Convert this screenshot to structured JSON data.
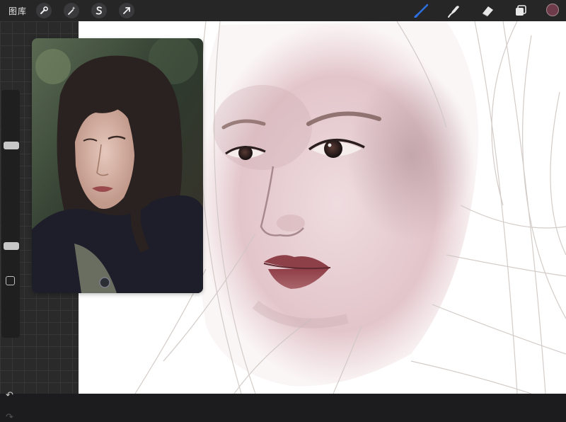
{
  "toolbar": {
    "gallery_label": "图库",
    "left_tools": [
      {
        "name": "actions",
        "icon": "wrench-icon"
      },
      {
        "name": "adjustments",
        "icon": "magic-wand-icon"
      },
      {
        "name": "selection",
        "icon": "selection-s-icon"
      },
      {
        "name": "transform",
        "icon": "arrow-cursor-icon"
      }
    ],
    "right_tools": [
      {
        "name": "brush",
        "icon": "brush-icon",
        "active": true
      },
      {
        "name": "smudge",
        "icon": "smudge-icon",
        "active": false
      },
      {
        "name": "eraser",
        "icon": "eraser-icon",
        "active": false
      },
      {
        "name": "layers",
        "icon": "layers-icon",
        "active": false
      }
    ],
    "active_color": "#6e3b4a",
    "accent_color": "#2d6fe0"
  },
  "sidebar": {
    "brush_size_level": 0.45,
    "opacity_level": 0.45,
    "undo_icon": "undo-arrow-icon",
    "redo_icon": "redo-arrow-icon"
  },
  "canvas": {
    "background": "#ffffff",
    "skin_tone": "#e7cdd1",
    "lip_color": "#8e4048",
    "sketch_line_color": "#cfc7c3"
  },
  "reference": {
    "hair_color": "#2a2220",
    "coat_color": "#1d1e2a",
    "background_color": "#3c4438"
  }
}
